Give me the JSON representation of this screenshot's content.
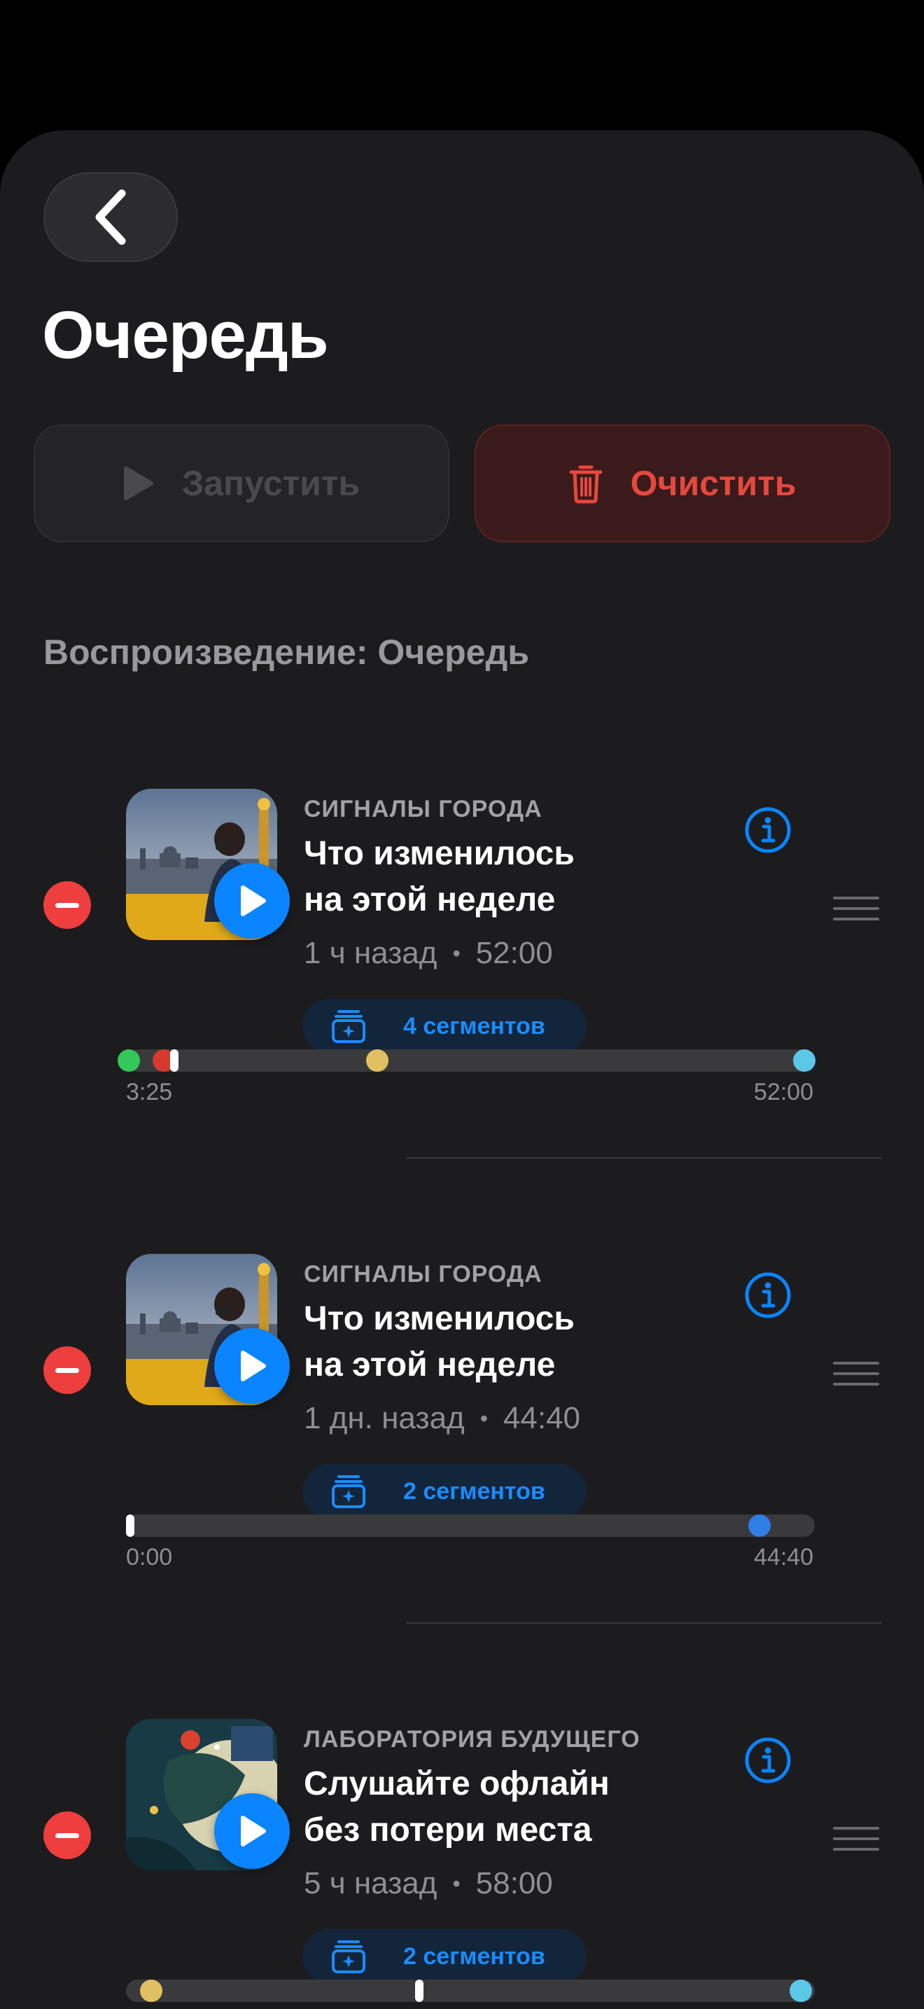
{
  "header": {
    "title": "Очередь",
    "start_label": "Запустить",
    "clear_label": "Очистить"
  },
  "section_title": "Воспроизведение: Очередь",
  "colors": {
    "accent": "#0a84ff",
    "destructive": "#e5483e",
    "segment_green": "#34c759",
    "segment_red": "#d63a2f",
    "segment_yellow": "#e0c060",
    "segment_cyan": "#5ac8e6",
    "segment_blue": "#2f7ee6"
  },
  "queue": [
    {
      "podcast": "СИГНАЛЫ ГОРОДА",
      "title_line1": "Что изменилось",
      "title_line2": "на этой неделе",
      "age": "1 ч назад",
      "duration": "52:00",
      "segments_label": "4 сегментов",
      "position_label": "3:25",
      "end_label": "52:00",
      "position_fraction": 0.07,
      "artwork": "person-with-binoculars-city",
      "track_dots": [
        {
          "fraction": 0.004,
          "color": "segment_green"
        },
        {
          "fraction": 0.055,
          "color": "segment_red"
        },
        {
          "fraction": 0.365,
          "color": "segment_yellow"
        },
        {
          "fraction": 0.985,
          "color": "segment_cyan"
        }
      ]
    },
    {
      "podcast": "СИГНАЛЫ ГОРОДА",
      "title_line1": "Что изменилось",
      "title_line2": "на этой неделе",
      "age": "1 дн. назад",
      "duration": "44:40",
      "segments_label": "2 сегментов",
      "position_label": "0:00",
      "end_label": "44:40",
      "position_fraction": 0.006,
      "artwork": "person-with-binoculars-city",
      "track_dots": [
        {
          "fraction": 0.92,
          "color": "segment_blue"
        }
      ]
    },
    {
      "podcast": "ЛАБОРАТОРИЯ БУДУЩЕГО",
      "title_line1": "Слушайте офлайн",
      "title_line2": "без потери места",
      "age": "5 ч назад",
      "duration": "58:00",
      "segments_label": "2 сегментов",
      "position_label": "",
      "end_label": "",
      "position_fraction": 0.426,
      "artwork": "abstract-space-collage",
      "track_dots": [
        {
          "fraction": 0.037,
          "color": "segment_yellow"
        },
        {
          "fraction": 0.98,
          "color": "segment_cyan"
        }
      ]
    }
  ]
}
